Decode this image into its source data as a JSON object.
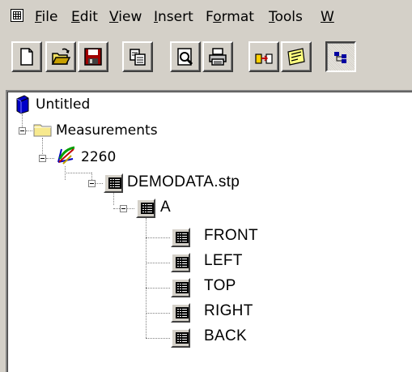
{
  "menubar": {
    "items": [
      {
        "label": "File",
        "mnemonic": "F",
        "rest": "ile"
      },
      {
        "label": "Edit",
        "mnemonic": "E",
        "rest": "dit"
      },
      {
        "label": "View",
        "mnemonic": "V",
        "rest": "iew"
      },
      {
        "label": "Insert",
        "mnemonic": "I",
        "rest": "nsert"
      },
      {
        "label": "Format",
        "pre": "F",
        "mnemonic": "o",
        "rest": "rmat"
      },
      {
        "label": "Tools",
        "mnemonic": "T",
        "rest": "ools"
      },
      {
        "label": "W",
        "mnemonic": "W",
        "rest": ""
      }
    ]
  },
  "toolbar": {
    "buttons": [
      {
        "icon": "new-document-icon"
      },
      {
        "icon": "open-folder-icon"
      },
      {
        "icon": "save-disk-icon"
      },
      {
        "icon": "copy-icon"
      },
      {
        "icon": "print-preview-icon"
      },
      {
        "icon": "print-icon"
      },
      {
        "icon": "measure-icon"
      },
      {
        "icon": "chart-icon"
      },
      {
        "icon": "tree-view-icon",
        "pressed": true
      }
    ]
  },
  "tree": {
    "root": "Untitled",
    "measurements": "Measurements",
    "instrument": "2260",
    "file": "DEMODATA.stp",
    "group": "A",
    "leaves": [
      "FRONT",
      "LEFT",
      "TOP",
      "RIGHT",
      "BACK"
    ]
  },
  "colors": {
    "face": "#d4d0c8",
    "pane": "#ffffff",
    "folder": "#f7e98e",
    "doc_blue": "#0000c8"
  }
}
